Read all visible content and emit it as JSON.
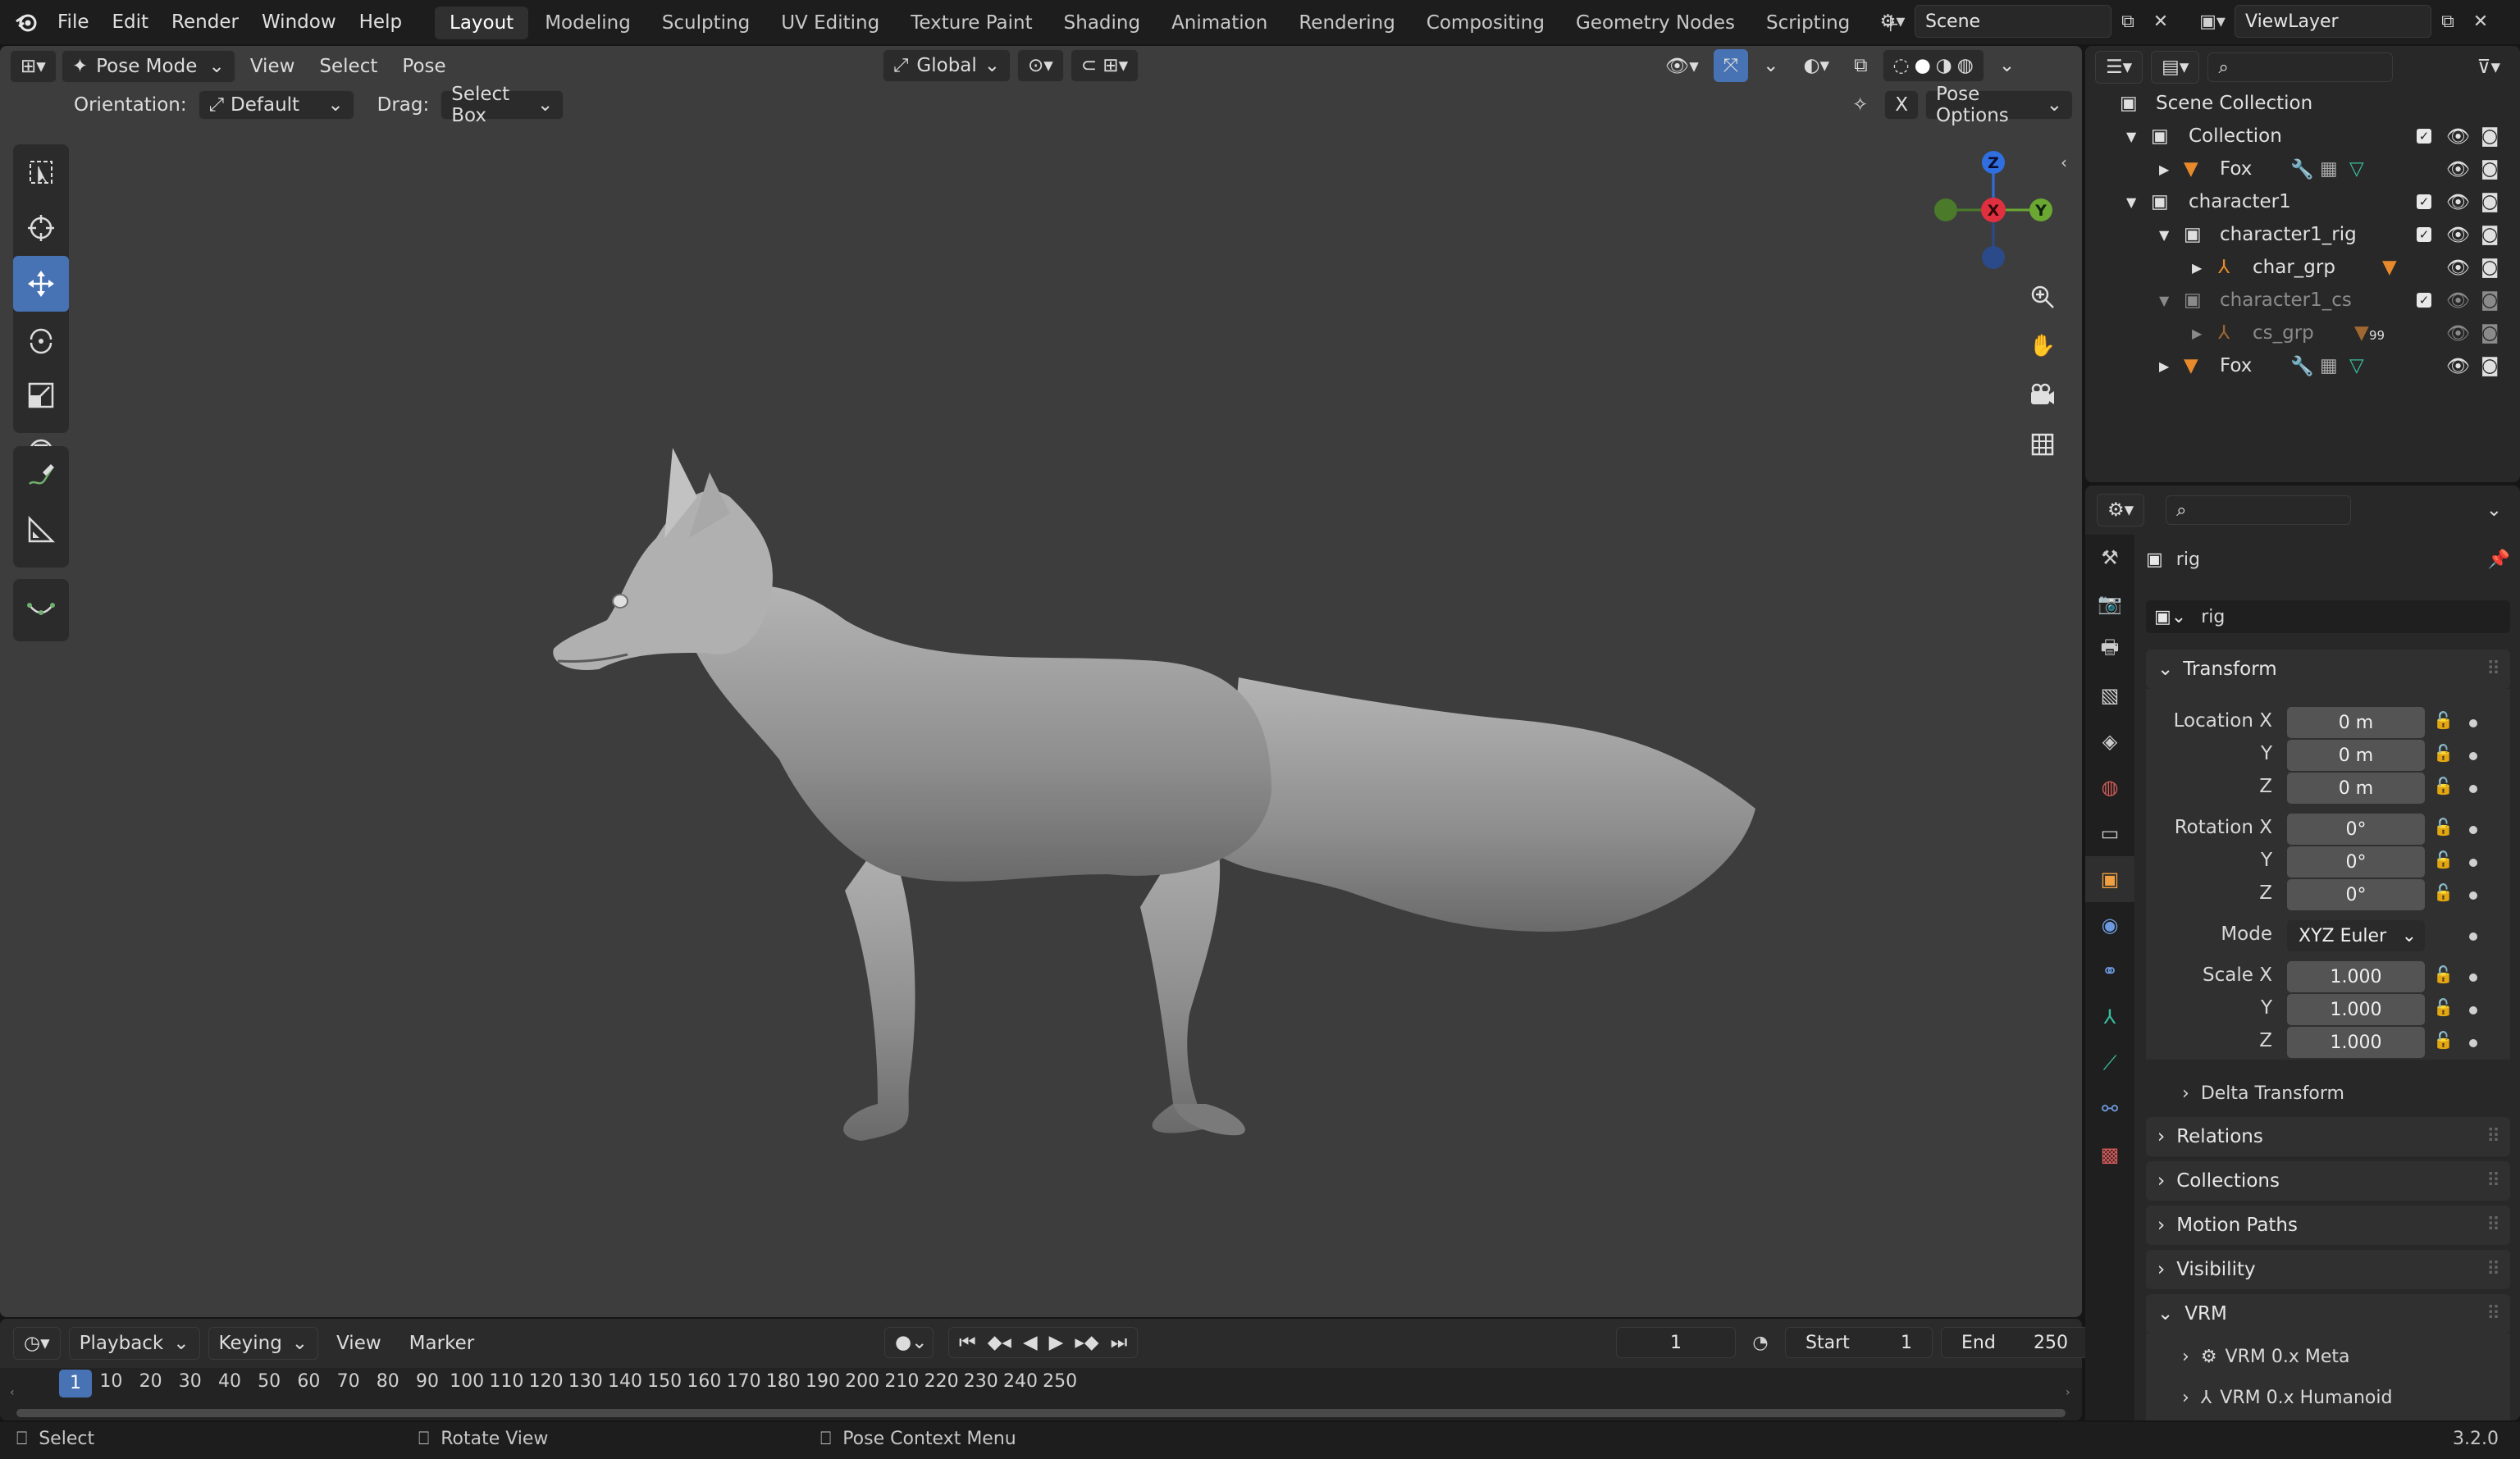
{
  "app": {
    "version": "3.2.0"
  },
  "menu": [
    "File",
    "Edit",
    "Render",
    "Window",
    "Help"
  ],
  "workspaces": [
    "Layout",
    "Modeling",
    "Sculpting",
    "UV Editing",
    "Texture Paint",
    "Shading",
    "Animation",
    "Rendering",
    "Compositing",
    "Geometry Nodes",
    "Scripting"
  ],
  "active_workspace": "Layout",
  "scene": {
    "name": "Scene"
  },
  "view_layer": {
    "name": "ViewLayer"
  },
  "viewport": {
    "mode": "Pose Mode",
    "menus": [
      "View",
      "Select",
      "Pose"
    ],
    "transform_orientation": "Global",
    "orientation_label": "Orientation:",
    "orientation_value": "Default",
    "drag_label": "Drag:",
    "drag_value": "Select Box",
    "pose_options": "Pose Options",
    "x_toggle": "X",
    "gizmo": {
      "z": "Z",
      "x": "X",
      "y": "Y"
    }
  },
  "outliner": {
    "root": "Scene Collection",
    "rows": [
      {
        "label": "Collection"
      },
      {
        "label": "Fox"
      },
      {
        "label": "character1"
      },
      {
        "label": "character1_rig"
      },
      {
        "label": "char_grp"
      },
      {
        "label": "character1_cs"
      },
      {
        "label": "cs_grp",
        "badge": "99"
      },
      {
        "label": "Fox"
      }
    ]
  },
  "properties": {
    "object_name": "rig",
    "datablock_name": "rig",
    "transform": {
      "title": "Transform",
      "location_label": "Location X",
      "rotation_label": "Rotation X",
      "scale_label": "Scale X",
      "mode_label": "Mode",
      "y_label": "Y",
      "z_label": "Z",
      "location": [
        "0 m",
        "0 m",
        "0 m"
      ],
      "rotation": [
        "0°",
        "0°",
        "0°"
      ],
      "mode": "XYZ Euler",
      "scale": [
        "1.000",
        "1.000",
        "1.000"
      ]
    },
    "subpanels": [
      "Delta Transform"
    ],
    "panels": [
      "Relations",
      "Collections",
      "Motion Paths",
      "Visibility",
      "VRM"
    ],
    "vrm_items": [
      "VRM 0.x Meta",
      "VRM 0.x Humanoid"
    ]
  },
  "timeline": {
    "menus": [
      "Playback",
      "Keying",
      "View",
      "Marker"
    ],
    "current_frame": "1",
    "start_label": "Start",
    "start": "1",
    "end_label": "End",
    "end": "250",
    "ruler": [
      "1",
      "10",
      "20",
      "30",
      "40",
      "50",
      "60",
      "70",
      "80",
      "90",
      "100",
      "110",
      "120",
      "130",
      "140",
      "150",
      "160",
      "170",
      "180",
      "190",
      "200",
      "210",
      "220",
      "230",
      "240",
      "250"
    ]
  },
  "statusbar": {
    "left": "Select",
    "middle": "Rotate View",
    "right": "Pose Context Menu"
  }
}
